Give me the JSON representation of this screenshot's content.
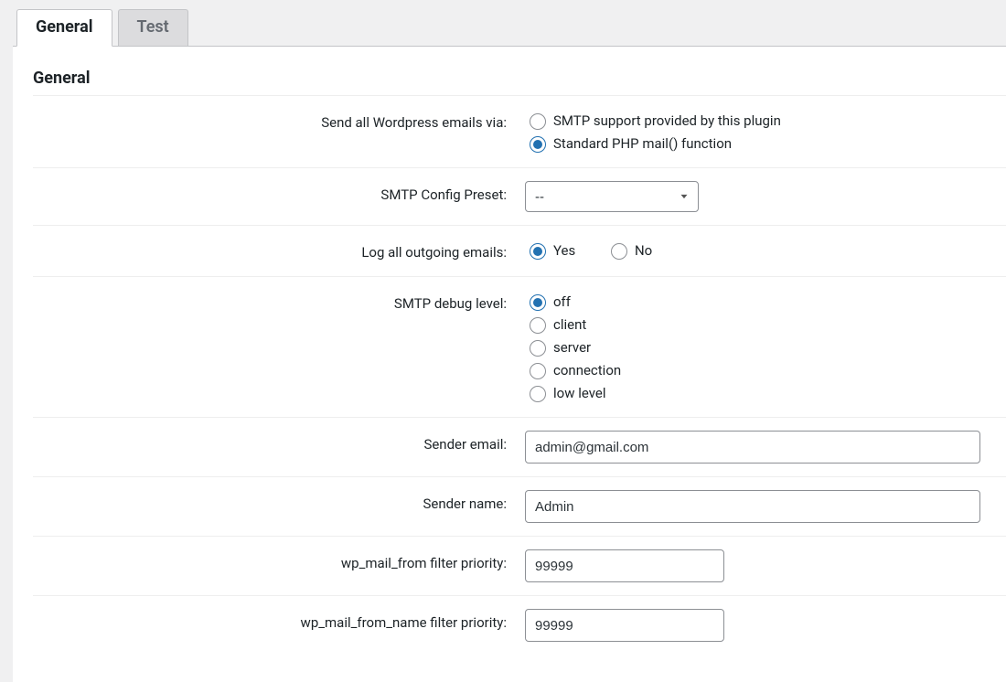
{
  "tabs": {
    "general": "General",
    "test": "Test"
  },
  "section_title": "General",
  "fields": {
    "send_via": {
      "label": "Send all Wordpress emails via:",
      "options": [
        "SMTP support provided by this plugin",
        "Standard PHP mail() function"
      ],
      "selected_index": 1
    },
    "preset": {
      "label": "SMTP Config Preset:",
      "value": "--",
      "options": [
        "--"
      ]
    },
    "log": {
      "label": "Log all outgoing emails:",
      "options": [
        "Yes",
        "No"
      ],
      "selected_index": 0
    },
    "debug": {
      "label": "SMTP debug level:",
      "options": [
        "off",
        "client",
        "server",
        "connection",
        "low level"
      ],
      "selected_index": 0
    },
    "sender_email": {
      "label": "Sender email:",
      "value": "admin@gmail.com"
    },
    "sender_name": {
      "label": "Sender name:",
      "value": "Admin"
    },
    "from_priority": {
      "label": "wp_mail_from filter priority:",
      "value": "99999"
    },
    "from_name_priority": {
      "label": "wp_mail_from_name filter priority:",
      "value": "99999"
    }
  }
}
